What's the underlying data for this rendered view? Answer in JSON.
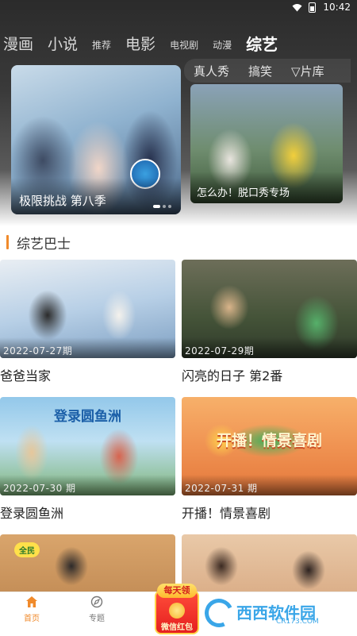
{
  "status_bar": {
    "time": "10:42"
  },
  "category_tabs": [
    {
      "label": "漫画",
      "size": "big"
    },
    {
      "label": "小说",
      "size": "big"
    },
    {
      "label": "推荐",
      "size": "small"
    },
    {
      "label": "电影",
      "size": "big"
    },
    {
      "label": "电视剧",
      "size": "small"
    },
    {
      "label": "动漫",
      "size": "small"
    },
    {
      "label": "综艺",
      "size": "active"
    }
  ],
  "sub_tabs": [
    "真人秀",
    "搞笑",
    "▽片库"
  ],
  "featured": {
    "main_title": "极限挑战 第八季",
    "side_title": "怎么办！脱口秀专场",
    "carousel_dots": 3,
    "active_dot": 1
  },
  "section": {
    "title": "综艺巴士",
    "accent": "#f08a2b"
  },
  "shows": [
    {
      "title": "爸爸当家",
      "episode": "2022-07-27期"
    },
    {
      "title": "闪亮的日子 第2番",
      "episode": "2022-07-29期"
    },
    {
      "title": "登录圆鱼洲",
      "episode": "2022-07-30 期",
      "banner": "登录圆鱼洲"
    },
    {
      "title": "开播！情景喜剧",
      "episode": "2022-07-31 期",
      "banner": "开播！情景喜剧"
    },
    {
      "title": "",
      "episode": ""
    },
    {
      "title": "",
      "episode": ""
    }
  ],
  "bottom_nav": {
    "home_label": "首页",
    "topic_label": "专题",
    "red_packet_top": "每天领",
    "red_packet_label": "微信红包"
  },
  "watermark": {
    "text": "西西软件园",
    "sub": "CR173.COM"
  }
}
